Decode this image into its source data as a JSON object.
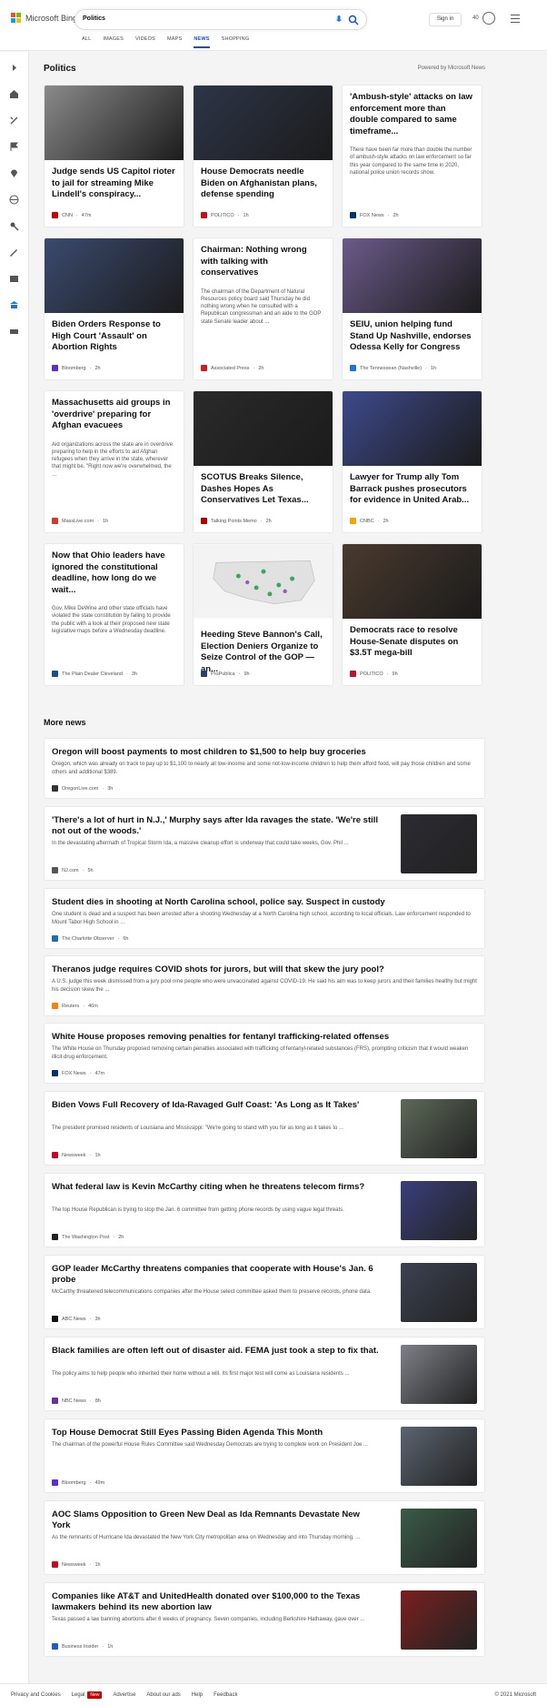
{
  "header": {
    "brand": "Microsoft Bing",
    "search_value": "Politics",
    "signin_label": "Sign in",
    "points": "40",
    "tabs": [
      "ALL",
      "IMAGES",
      "VIDEOS",
      "MAPS",
      "NEWS",
      "SHOPPING"
    ],
    "active_tab": "NEWS"
  },
  "section": {
    "title": "Politics",
    "powered_by": "Powered by Microsoft News"
  },
  "cards": [
    {
      "title": "Judge sends US Capitol rioter to jail for streaming Mike Lindell's conspiracy...",
      "snippet": "",
      "source": "CNN",
      "time": "47m",
      "icon_color": "#cc0000",
      "img": "#8a8a8a"
    },
    {
      "title": "House Democrats needle Biden on Afghanistan plans, defense spending",
      "snippet": "",
      "source": "POLITICO",
      "time": "1h",
      "icon_color": "#c1121f",
      "img": "#2d3548"
    },
    {
      "title": "'Ambush-style' attacks on law enforcement more than double compared to same timeframe...",
      "snippet": "There have been far more than double the number of ambush-style attacks on law enforcement so far this year compared to the same time in 2020, national police union records show.",
      "source": "FOX News",
      "time": "2h",
      "icon_color": "#003366",
      "img": ""
    },
    {
      "title": "Biden Orders Response to High Court 'Assault' on Abortion Rights",
      "snippet": "",
      "source": "Bloomberg",
      "time": "2h",
      "icon_color": "#5b2be0",
      "img": "#3a4a6e"
    },
    {
      "title": "Chairman: Nothing wrong with talking with conservatives",
      "snippet": "The chairman of the Department of Natural Resources policy board said Thursday he did nothing wrong when he consulted with a Republican congressman and an aide to the GOP state Senate leader about ...",
      "source": "Associated Press",
      "time": "2h",
      "icon_color": "#d71920",
      "img": ""
    },
    {
      "title": "SEIU, union helping fund Stand Up Nashville, endorses Odessa Kelly for Congress",
      "snippet": "",
      "source": "The Tennessean (Nashville)",
      "time": "1h",
      "icon_color": "#1a73e8",
      "img": "#6b5a8a"
    },
    {
      "title": "Massachusetts aid groups in 'overdrive' preparing for Afghan evacuees",
      "snippet": "Aid organizations across the state are in overdrive preparing to help in the efforts to aid Afghan refugees when they arrive in the state, wherever that might be. \"Right now we're overwhelmed, the ...",
      "source": "MassLive.com",
      "time": "1h",
      "icon_color": "#d9362b",
      "img": ""
    },
    {
      "title": "SCOTUS Breaks Silence, Dashes Hopes As Conservatives Let Texas...",
      "snippet": "",
      "source": "Talking Points Memo",
      "time": "2h",
      "icon_color": "#b30000",
      "img": "#2a2a2a"
    },
    {
      "title": "Lawyer for Trump ally Tom Barrack pushes prosecutors for evidence in United Arab...",
      "snippet": "",
      "source": "CNBC",
      "time": "2h",
      "icon_color": "#f4a300",
      "img": "#3d4a8c"
    },
    {
      "title": "Now that Ohio leaders have ignored the constitutional deadline, how long do we wait...",
      "snippet": "Gov. Mike DeWine and other state officials have violated the state constitution by failing to provide the public with a look at their proposed new state legislative maps before a Wednesday deadline.",
      "source": "The Plain Dealer Cleveland",
      "time": "3h",
      "icon_color": "#1c4e80",
      "img": ""
    },
    {
      "title": "Heeding Steve Bannon's Call, Election Deniers Organize to Seize Control of the GOP — an...",
      "snippet": "",
      "source": "ProPublica",
      "time": "9h",
      "icon_color": "#2a3f6d",
      "img": "map"
    },
    {
      "title": "Democrats race to resolve House-Senate disputes on $3.5T mega-bill",
      "snippet": "",
      "source": "POLITICO",
      "time": "9h",
      "icon_color": "#c1121f",
      "img": "#4a3a2e"
    }
  ],
  "more": {
    "title": "More news",
    "items": [
      {
        "title": "Oregon will boost payments to most children to $1,500 to help buy groceries",
        "snippet": "Oregon, which was already on track to pay up to $1,100 to nearly all low-income and some not-low-income children to help them afford food, will pay those children and some others and additional $389.",
        "source": "OregonLive.com",
        "time": "3h",
        "icon_color": "#333333",
        "thumb": ""
      },
      {
        "title": "'There's a lot of hurt in N.J.,' Murphy says after Ida ravages the state. 'We're still not out of the woods.'",
        "snippet": "In the devastating aftermath of Tropical Storm Ida, a massive cleanup effort is underway that could take weeks, Gov. Phil ...",
        "source": "NJ.com",
        "time": "5h",
        "icon_color": "#555555",
        "thumb": "#2b2b33"
      },
      {
        "title": "Student dies in shooting at North Carolina school, police say. Suspect in custody",
        "snippet": "One student is dead and a suspect has been arrested after a shooting Wednesday at a North Carolina high school, according to local officials. Law enforcement responded to Mount Tabor High School in ...",
        "source": "The Charlotte Observer",
        "time": "6h",
        "icon_color": "#1a6fb5",
        "thumb": ""
      },
      {
        "title": "Theranos judge requires COVID shots for jurors, but will that skew the jury pool?",
        "snippet": "A U.S. judge this week dismissed from a jury pool nine people who were unvaccinated against COVID-19. He said his aim was to keep jurors and their families healthy but might his decision skew the ...",
        "source": "Reuters",
        "time": "46m",
        "icon_color": "#ff8000",
        "thumb": ""
      },
      {
        "title": "White House proposes removing penalties for fentanyl trafficking-related offenses",
        "snippet": "The White House on Thursday proposed removing certain penalties associated with trafficking of fentanyl-related substances (FRS), prompting criticism that it would weaken illicit drug enforcement.",
        "source": "FOX News",
        "time": "47m",
        "icon_color": "#003366",
        "thumb": ""
      },
      {
        "title": "Biden Vows Full Recovery of Ida-Ravaged Gulf Coast: 'As Long as It Takes'",
        "snippet": "The president promised residents of Louisiana and Mississippi: \"We're going to stand with you for as long as it takes to ...",
        "source": "Newsweek",
        "time": "1h",
        "icon_color": "#d0021b",
        "thumb": "#5d6a58"
      },
      {
        "title": "What federal law is Kevin McCarthy citing when he threatens telecom firms?",
        "snippet": "The top House Republican is trying to stop the Jan. 6 committee from getting phone records by using vague legal threats.",
        "source": "The Washington Post",
        "time": "2h",
        "icon_color": "#222222",
        "thumb": "#3a3f7a"
      },
      {
        "title": "GOP leader McCarthy threatens companies that cooperate with House's Jan. 6 probe",
        "snippet": "McCarthy threatened telecommunications companies after the House select committee asked them to preserve records, phone data.",
        "source": "ABC News",
        "time": "3h",
        "icon_color": "#111111",
        "thumb": "#3b4252"
      },
      {
        "title": "Black families are often left out of disaster aid. FEMA just took a step to fix that.",
        "snippet": "The policy aims to help people who inherited their home without a will. Its first major test will come as Louisiana residents ...",
        "source": "NBC News",
        "time": "8h",
        "icon_color": "#6c2fa0",
        "thumb": "#7d8088"
      },
      {
        "title": "Top House Democrat Still Eyes Passing Biden Agenda This Month",
        "snippet": "The chairman of the powerful House Rules Committee said Wednesday Democrats are trying to complete work on President Joe ...",
        "source": "Bloomberg",
        "time": "49m",
        "icon_color": "#5b2be0",
        "thumb": "#5a6470"
      },
      {
        "title": "AOC Slams Opposition to Green New Deal as Ida Remnants Devastate New York",
        "snippet": "As the remnants of Hurricane Ida devastated the New York City metropolitan area on Wednesday and into Thursday morning, ...",
        "source": "Newsweek",
        "time": "1h",
        "icon_color": "#d0021b",
        "thumb": "#3b5b48"
      },
      {
        "title": "Companies like AT&T and UnitedHealth donated over $100,000 to the Texas lawmakers behind its new abortion law",
        "snippet": "Texas passed a law banning abortions after 6 weeks of pregnancy. Seven companies, including Berkshire Hathaway, gave over ...",
        "source": "Business Insider",
        "time": "1h",
        "icon_color": "#1a5bd6",
        "thumb": "#7a2020"
      }
    ]
  },
  "footer": {
    "links": [
      "Privacy and Cookies",
      "Legal",
      "Advertise",
      "About our ads",
      "Help",
      "Feedback"
    ],
    "new_badge": "New",
    "copyright": "© 2021 Microsoft"
  }
}
